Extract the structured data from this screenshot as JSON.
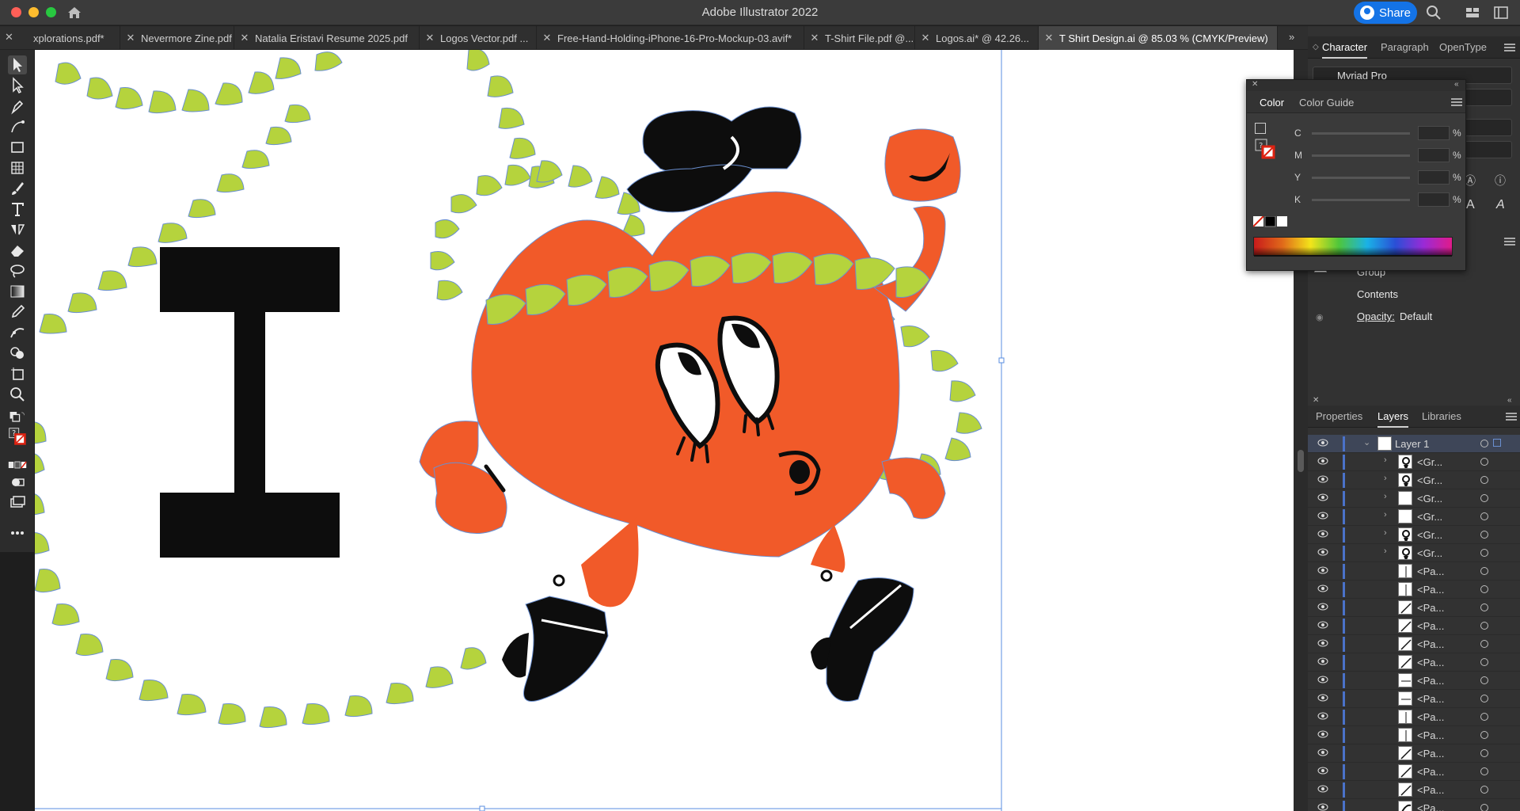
{
  "window": {
    "title": "Adobe Illustrator 2022",
    "share_label": "Share"
  },
  "tabs": [
    {
      "label": "xplorations.pdf*"
    },
    {
      "label": "Nevermore Zine.pdf"
    },
    {
      "label": "Natalia Eristavi Resume 2025.pdf"
    },
    {
      "label": "Logos Vector.pdf ..."
    },
    {
      "label": "Free-Hand-Holding-iPhone-16-Pro-Mockup-03.avif*"
    },
    {
      "label": "T-Shirt File.pdf @..."
    },
    {
      "label": "Logos.ai* @ 42.26..."
    },
    {
      "label": "T Shirt Design.ai @ 85.03 % (CMYK/Preview)",
      "active": true
    }
  ],
  "tab_overflow": "»",
  "character_panel": {
    "tabs": [
      "Character",
      "Paragraph",
      "OpenType"
    ],
    "font": "Myriad Pro"
  },
  "color_panel": {
    "tabs": [
      "Color",
      "Color Guide"
    ],
    "channels": [
      {
        "label": "C",
        "unit": "%"
      },
      {
        "label": "M",
        "unit": "%"
      },
      {
        "label": "Y",
        "unit": "%"
      },
      {
        "label": "K",
        "unit": "%"
      }
    ],
    "question": "?"
  },
  "appearance": {
    "group": "Group",
    "contents": "Contents",
    "opacity_label": "Opacity:",
    "opacity_value": "Default"
  },
  "layers_panel": {
    "tabs": [
      "Properties",
      "Layers",
      "Libraries"
    ],
    "top_layer": "Layer 1",
    "rows": [
      "<Gr...",
      "<Gr...",
      "<Gr...",
      "<Gr...",
      "<Gr...",
      "<Gr...",
      "<Pa...",
      "<Pa...",
      "<Pa...",
      "<Pa...",
      "<Pa...",
      "<Pa...",
      "<Pa...",
      "<Pa...",
      "<Pa...",
      "<Pa...",
      "<Pa...",
      "<Pa...",
      "<Pa...",
      "<Pa..."
    ]
  },
  "artwork": {
    "letter": "I"
  },
  "colors": {
    "heart": "#f15a29",
    "rope": "#b5d33d",
    "ink": "#0d0d0d",
    "accent_blue": "#1473e6"
  }
}
